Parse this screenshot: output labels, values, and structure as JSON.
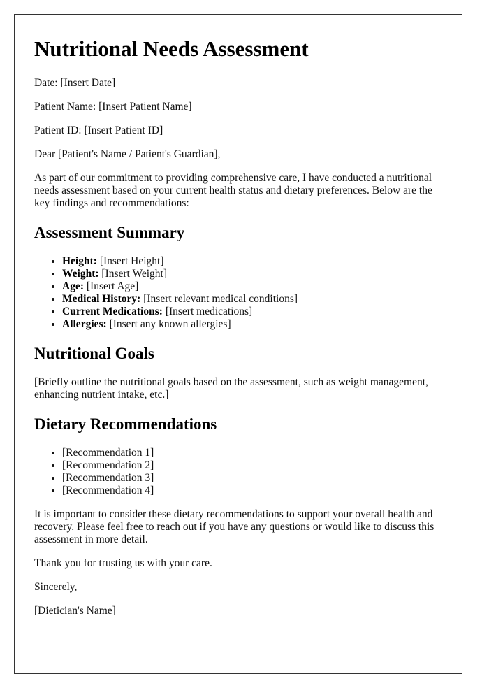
{
  "document": {
    "title": "Nutritional Needs Assessment",
    "header_fields": [
      {
        "label": "Date:",
        "value": "[Insert Date]"
      },
      {
        "label": "Patient Name:",
        "value": "[Insert Patient Name]"
      },
      {
        "label": "Patient ID:",
        "value": "[Insert Patient ID]"
      }
    ],
    "salutation": "Dear [Patient's Name / Patient's Guardian],",
    "intro": "As part of our commitment to providing comprehensive care, I have conducted a nutritional needs assessment based on your current health status and dietary preferences. Below are the key findings and recommendations:",
    "summary": {
      "heading": "Assessment Summary",
      "items": [
        {
          "label": "Height:",
          "value": "[Insert Height]"
        },
        {
          "label": "Weight:",
          "value": "[Insert Weight]"
        },
        {
          "label": "Age:",
          "value": "[Insert Age]"
        },
        {
          "label": "Medical History:",
          "value": "[Insert relevant medical conditions]"
        },
        {
          "label": "Current Medications:",
          "value": "[Insert medications]"
        },
        {
          "label": "Allergies:",
          "value": "[Insert any known allergies]"
        }
      ]
    },
    "goals": {
      "heading": "Nutritional Goals",
      "text": "[Briefly outline the nutritional goals based on the assessment, such as weight management, enhancing nutrient intake, etc.]"
    },
    "recommendations": {
      "heading": "Dietary Recommendations",
      "items": [
        "[Recommendation 1]",
        "[Recommendation 2]",
        "[Recommendation 3]",
        "[Recommendation 4]"
      ]
    },
    "closing_paragraph": "It is important to consider these dietary recommendations to support your overall health and recovery. Please feel free to reach out if you have any questions or would like to discuss this assessment in more detail.",
    "thanks": "Thank you for trusting us with your care.",
    "sign_off": "Sincerely,",
    "signature": "[Dietician's Name]"
  }
}
